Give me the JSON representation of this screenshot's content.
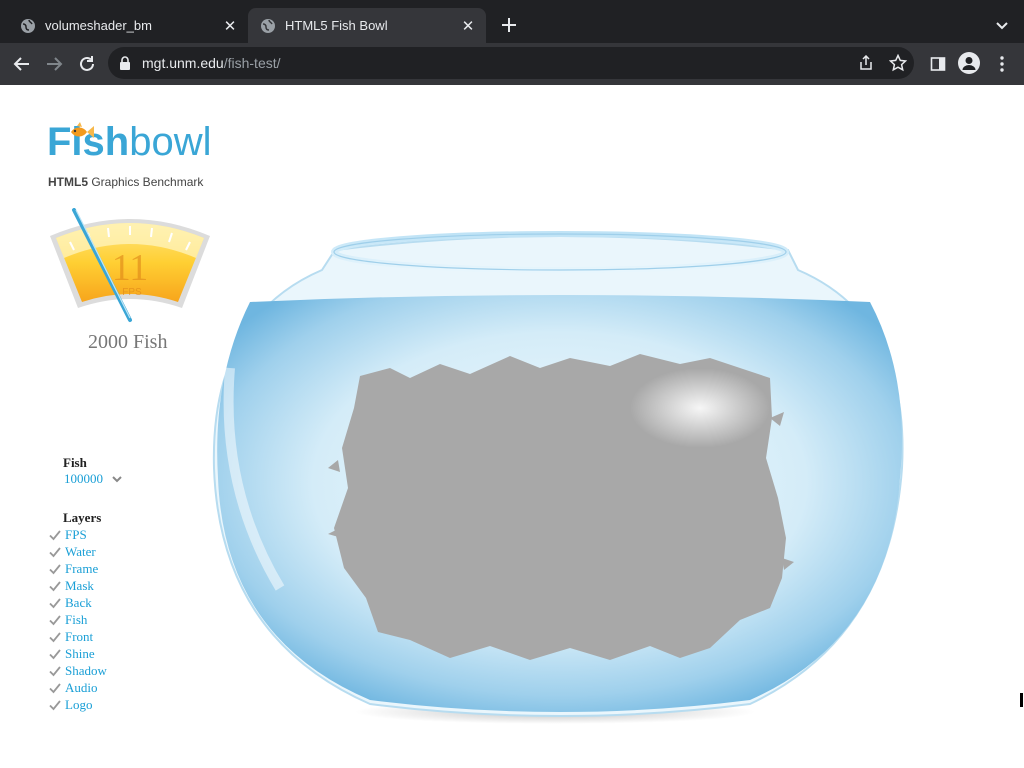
{
  "browser": {
    "tabs": [
      {
        "title": "volumeshader_bm",
        "active": false
      },
      {
        "title": "HTML5 Fish Bowl",
        "active": true
      }
    ],
    "address": {
      "host": "mgt.unm.edu",
      "path": "/fish-test/"
    }
  },
  "page": {
    "logo": {
      "fish": "Fish",
      "bowl": "bowl",
      "sub_bold": "HTML5",
      "sub_rest": " Graphics Benchmark"
    },
    "gauge": {
      "value": "11",
      "unit": "FPS"
    },
    "fish_count": "2000 Fish",
    "controls": {
      "fish_heading": "Fish",
      "fish_value": "100000",
      "layers_heading": "Layers",
      "layers": [
        "FPS",
        "Water",
        "Frame",
        "Mask",
        "Back",
        "Fish",
        "Front",
        "Shine",
        "Shadow",
        "Audio",
        "Logo"
      ]
    }
  },
  "colors": {
    "brand": "#3aa6d6",
    "link": "#1a9fd6",
    "chrome_dark": "#202124",
    "chrome_toolbar": "#35363a"
  }
}
